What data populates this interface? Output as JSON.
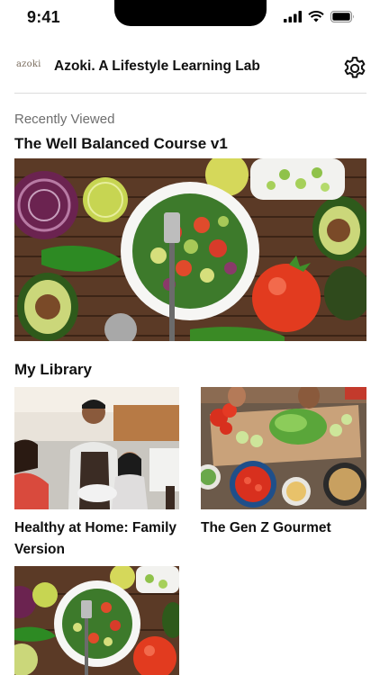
{
  "status_bar": {
    "time": "9:41"
  },
  "header": {
    "logo_text": "azoki",
    "title": "Azoki. A Lifestyle Learning Lab",
    "settings_icon": "gear-icon"
  },
  "recently_viewed": {
    "label": "Recently Viewed",
    "course_title": "The Well Balanced Course v1"
  },
  "library": {
    "title": "My Library",
    "items": [
      {
        "title": "Healthy at Home: Family Version"
      },
      {
        "title": "The Gen Z Gourmet"
      },
      {
        "title": ""
      }
    ]
  },
  "colors": {
    "accent": "#111111",
    "muted": "#6e6e6e",
    "divider": "#dcdcdc"
  }
}
